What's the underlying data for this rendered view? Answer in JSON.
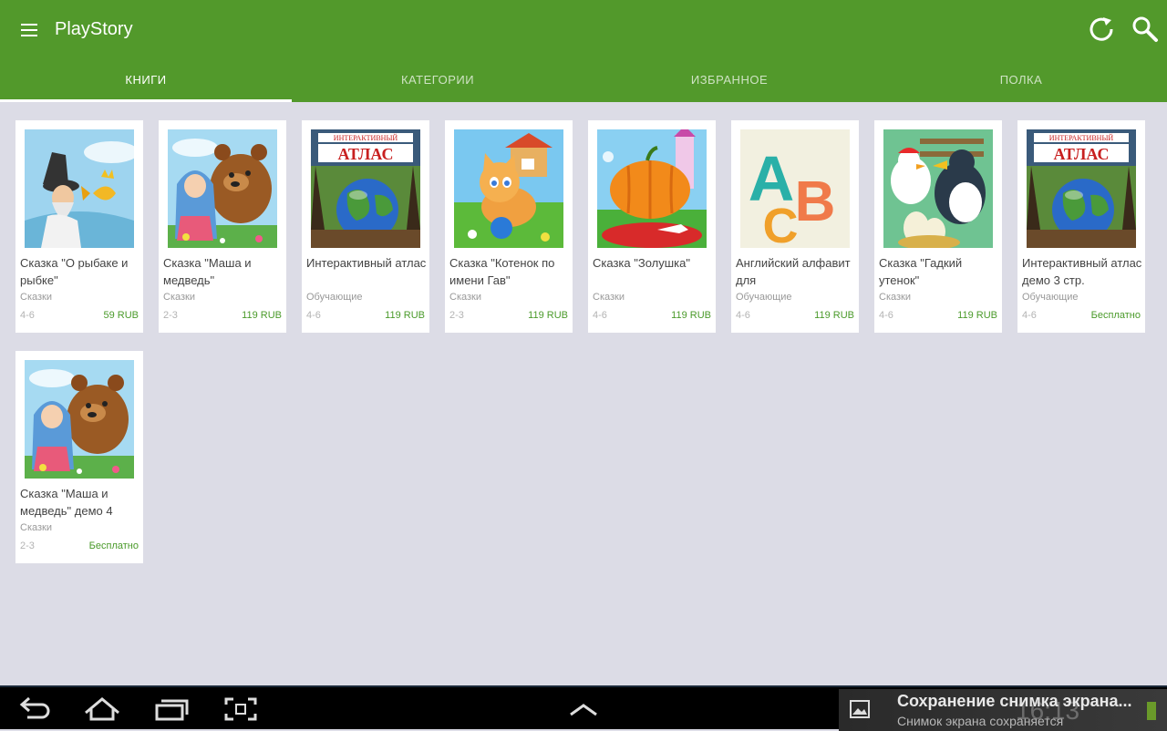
{
  "app": {
    "title": "PlayStory"
  },
  "icons": {
    "menu": "menu-icon",
    "refresh": "refresh-icon",
    "search": "search-icon"
  },
  "colors": {
    "primary": "#52992b",
    "price": "#4a9a2a",
    "background": "#dcdce6"
  },
  "tabs": [
    {
      "label": "КНИГИ",
      "active": true
    },
    {
      "label": "КАТЕГОРИИ",
      "active": false
    },
    {
      "label": "ИЗБРАННОЕ",
      "active": false
    },
    {
      "label": "ПОЛКА",
      "active": false
    }
  ],
  "books": [
    {
      "title": "Сказка \"О рыбаке и рыбке\"",
      "category": "Сказки",
      "age": "4-6",
      "price": "59 RUB",
      "cover": "fisherman"
    },
    {
      "title": "Сказка \"Маша и медведь\"",
      "category": "Сказки",
      "age": "2-3",
      "price": "119 RUB",
      "cover": "masha"
    },
    {
      "title": "Интерактивный атлас",
      "category": "Обучающие",
      "age": "4-6",
      "price": "119 RUB",
      "cover": "atlas"
    },
    {
      "title": "Сказка \"Котенок по имени Гав\"",
      "category": "Сказки",
      "age": "2-3",
      "price": "119 RUB",
      "cover": "kitten"
    },
    {
      "title": "Сказка \"Золушка\"",
      "category": "Сказки",
      "age": "4-6",
      "price": "119 RUB",
      "cover": "cinderella"
    },
    {
      "title": "Английский алфавит для",
      "category": "Обучающие",
      "age": "4-6",
      "price": "119 RUB",
      "cover": "abc"
    },
    {
      "title": "Сказка \"Гадкий утенок\"",
      "category": "Сказки",
      "age": "4-6",
      "price": "119 RUB",
      "cover": "duckling"
    },
    {
      "title": "Интерактивный атлас демо 3 стр.",
      "category": "Обучающие",
      "age": "4-6",
      "price": "Бесплатно",
      "cover": "atlas"
    },
    {
      "title": "Сказка \"Маша и медведь\" демо 4",
      "category": "Сказки",
      "age": "2-3",
      "price": "Бесплатно",
      "cover": "masha"
    }
  ],
  "atlas_cover": {
    "top": "ИНТЕРАКТИВНЫЙ",
    "main": "АТЛАС"
  },
  "abc_cover": {
    "letters": "ABC"
  },
  "navbar": {
    "buttons": [
      "back-icon",
      "home-icon",
      "recent-apps-icon",
      "screenshot-icon",
      "chevron-up-icon"
    ],
    "notification": {
      "title": "Сохранение снимка экрана...",
      "text": "Снимок экрана сохраняется"
    },
    "clock": "16:13"
  }
}
